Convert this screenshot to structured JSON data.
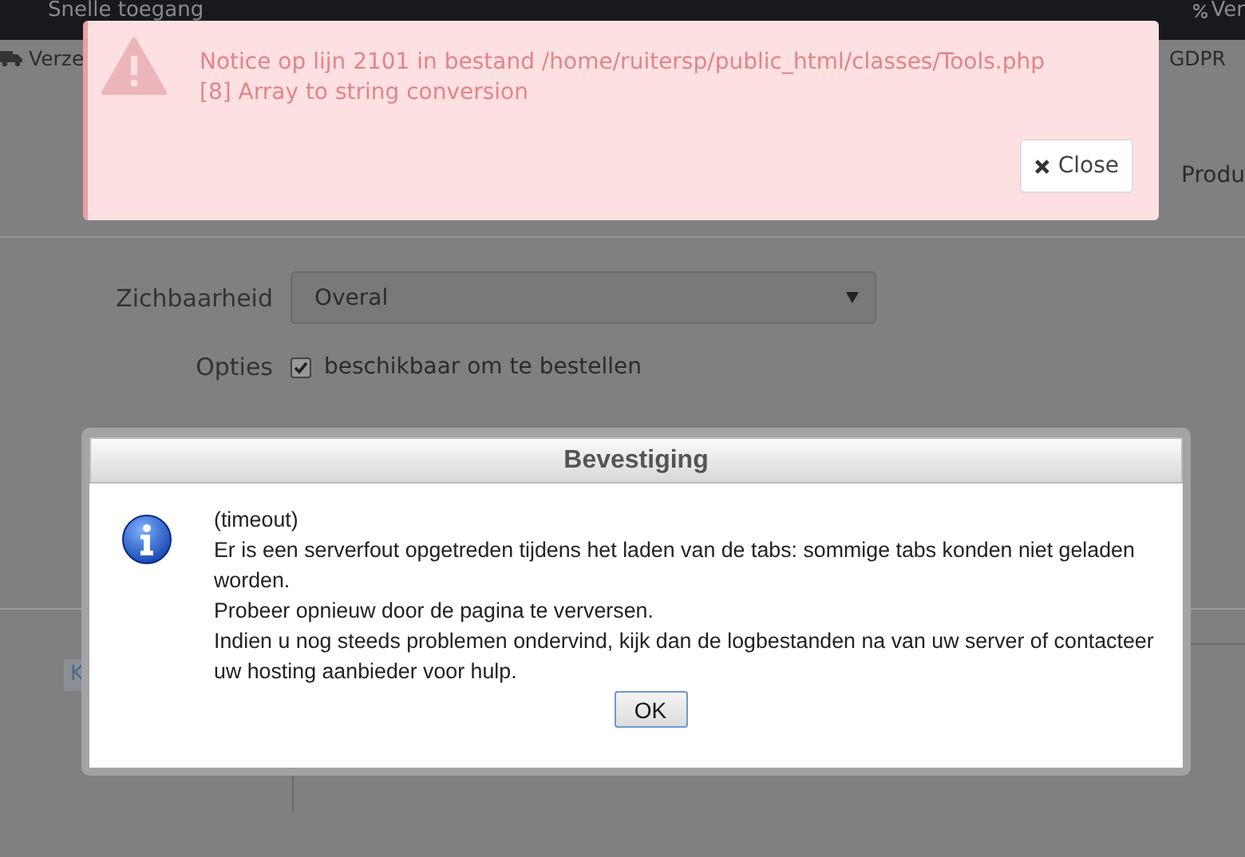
{
  "top_bar": {
    "menu": "Snelle toegang",
    "right": "Ver"
  },
  "nav": {
    "left": "Verze",
    "right": "GDPR"
  },
  "tab": "Produ",
  "form": {
    "visibility": {
      "label": "Zichbaarheid",
      "value": "Overal"
    },
    "options": {
      "label": "Opties",
      "checkbox": {
        "label": "beschikbaar om te bestellen",
        "checked": true
      }
    }
  },
  "editor": {
    "tag": "K"
  },
  "notice": {
    "lines": [
      "Notice op lijn 2101 in bestand /home/ruitersp/public_html/classes/Tools.php",
      "[8] Array to string conversion"
    ],
    "close_button": "Close"
  },
  "dialog": {
    "title": "Bevestiging",
    "lines": [
      "(timeout)",
      "Er is een serverfout opgetreden tijdens het laden van de tabs: sommige tabs konden niet geladen worden.",
      "Probeer opnieuw door de pagina te verversen.",
      "Indien u nog steeds problemen ondervind, kijk dan de logbestanden na van uw server of contacteer uw hosting aanbieder voor hulp."
    ],
    "ok_button": "OK"
  }
}
